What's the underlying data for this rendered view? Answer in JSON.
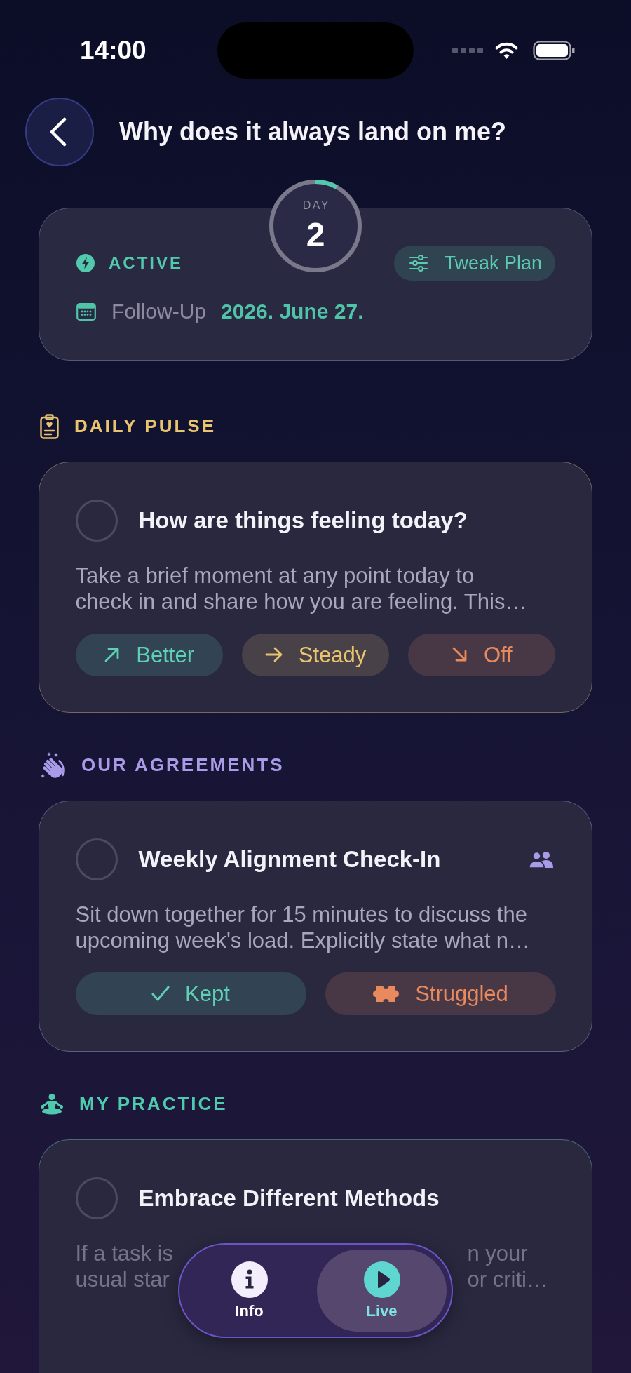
{
  "status_bar": {
    "time": "14:00"
  },
  "header": {
    "title": "Why does it always land on me?"
  },
  "plan": {
    "day_label": "DAY",
    "day": "2",
    "level": 0.08,
    "status": "ACTIVE",
    "tweak_button": "Tweak Plan",
    "follow_up_label": "Follow-Up",
    "follow_up_date": "2026. June 27."
  },
  "sections": [
    {
      "kind": "pulse",
      "title": "DAILY PULSE",
      "color": "#e8c470",
      "item": {
        "title": "How are things feeling today?",
        "checked": false,
        "shared": false,
        "description": "Take a brief moment at any point today to check in and share how you are feeling. This…",
        "actions": [
          {
            "label": "Better",
            "kind": "rise",
            "color": "#5dd0b5"
          },
          {
            "label": "Steady",
            "kind": "flat",
            "color": "#e8c470"
          },
          {
            "label": "Off",
            "kind": "fall",
            "color": "#e88a5e"
          }
        ]
      }
    },
    {
      "kind": "agreements",
      "title": "OUR AGREEMENTS",
      "color": "#a99be8",
      "item": {
        "title": "Weekly Alignment Check-In",
        "checked": false,
        "shared": true,
        "description": "Sit down together for 15 minutes to discuss the upcoming week's load. Explicitly state what n…",
        "actions": [
          {
            "label": "Kept",
            "kind": "check",
            "color": "#5dd0b5"
          },
          {
            "label": "Struggled",
            "kind": "puzzle",
            "color": "#e88a5e"
          }
        ]
      }
    },
    {
      "kind": "practice",
      "title": "MY PRACTICE",
      "color": "#4fcaae",
      "item": {
        "title": "Embrace Different Methods",
        "checked": false,
        "shared": false,
        "description_lines": [
          {
            "left": "If a task is",
            "right": "n your"
          },
          {
            "left": "usual star",
            "right": "or criti…"
          }
        ]
      }
    }
  ],
  "tab_bar": [
    {
      "label": "Info",
      "kind": "info",
      "selected": false
    },
    {
      "label": "Live",
      "kind": "live",
      "selected": true
    }
  ]
}
